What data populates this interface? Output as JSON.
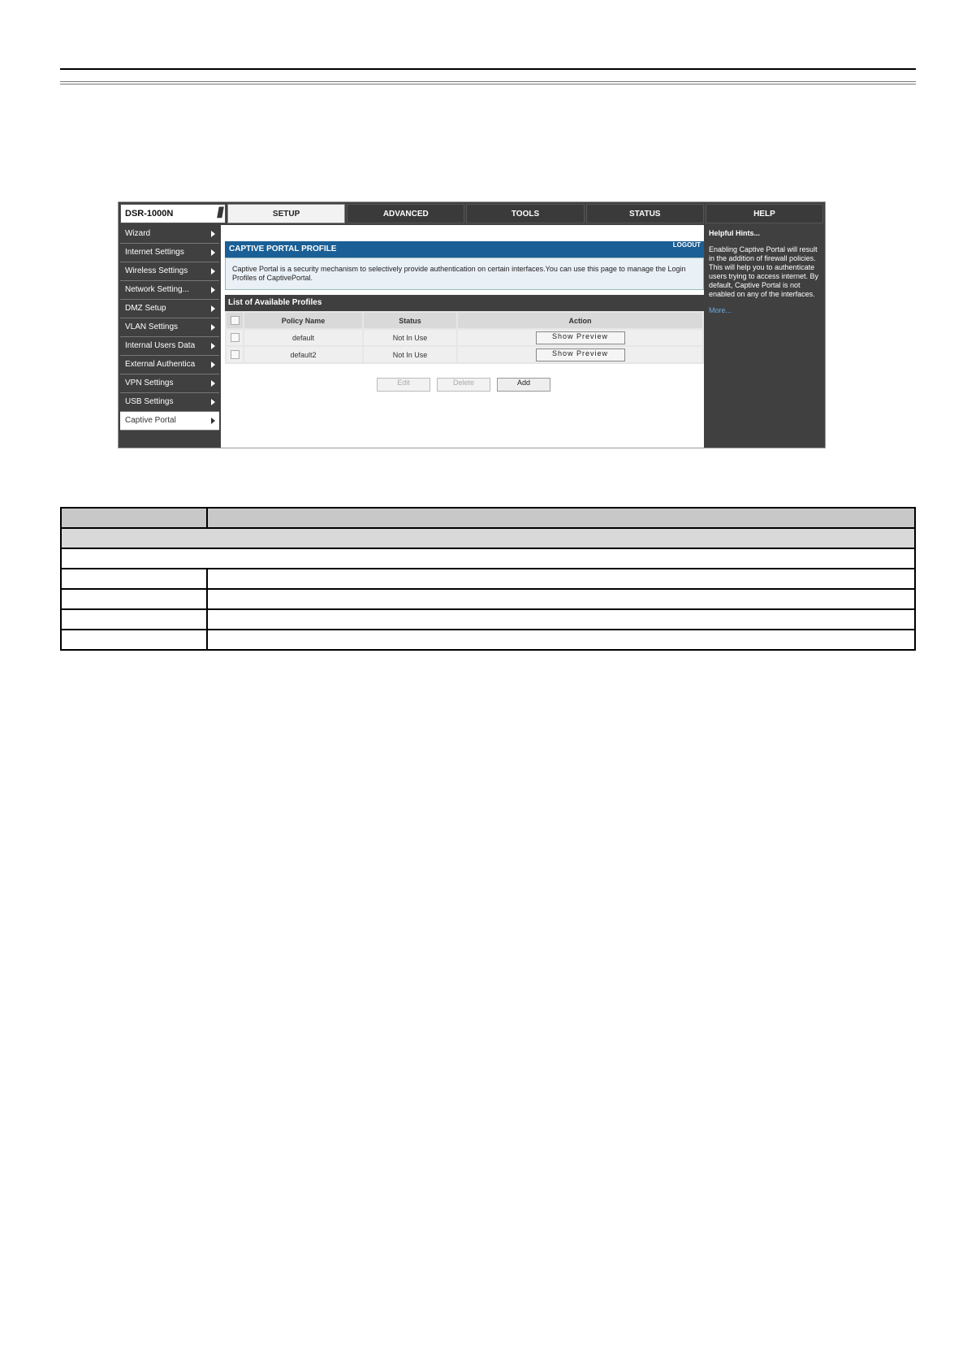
{
  "app": {
    "model": "DSR-1000N"
  },
  "nav": {
    "tabs": [
      "SETUP",
      "ADVANCED",
      "TOOLS",
      "STATUS",
      "HELP"
    ]
  },
  "sidebar": {
    "items": [
      "Wizard",
      "Internet Settings",
      "Wireless Settings",
      "Network Setting...",
      "DMZ Setup",
      "VLAN Settings",
      "Internal Users Data",
      "External Authentica",
      "VPN Settings",
      "USB Settings",
      "Captive Portal"
    ]
  },
  "main": {
    "title": "CAPTIVE PORTAL PROFILE",
    "logout": "LOGOUT",
    "description": "Captive Portal is a security mechanism to selectively provide authentication on certain interfaces.You can use this page to manage the Login Profiles of CaptivePortal.",
    "list_title": "List of Available Profiles",
    "columns": [
      "Policy Name",
      "Status",
      "Action"
    ],
    "rows": [
      {
        "name": "default",
        "status": "Not In Use",
        "action": "Show Preview"
      },
      {
        "name": "default2",
        "status": "Not In Use",
        "action": "Show Preview"
      }
    ],
    "buttons": {
      "edit": "Edit",
      "delete": "Delete",
      "add": "Add"
    }
  },
  "help": {
    "title": "Helpful Hints...",
    "text": "Enabling Captive Portal will result in the addition of firewall policies. This will help you to authenticate users trying to access internet. By default, Captive Portal is not enabled on any of the interfaces.",
    "more": "More..."
  }
}
